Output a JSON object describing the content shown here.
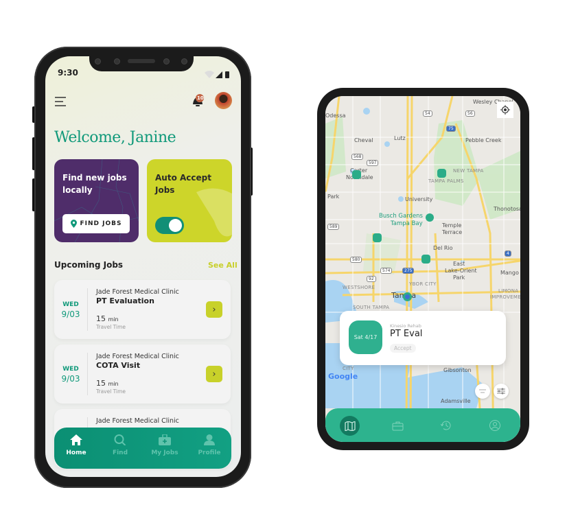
{
  "colors": {
    "brand_green": "#10997a",
    "purple": "#4f2d6a",
    "lime": "#cdd52a",
    "map_accent": "#2db38e"
  },
  "phone_home": {
    "status": {
      "time": "9:30"
    },
    "header": {
      "menu_icon": "hamburger-icon",
      "notification_count": "10",
      "avatar": "user-avatar"
    },
    "welcome": "Welcome, Janine",
    "cards": {
      "find": {
        "title": "Find new jobs locally",
        "button": "FIND JOBS"
      },
      "auto": {
        "title": "Auto Accept Jobs",
        "toggle_on": true
      }
    },
    "upcoming": {
      "title": "Upcoming Jobs",
      "see_all": "See All"
    },
    "jobs": [
      {
        "day": "WED",
        "date": "9/03",
        "clinic": "Jade Forest Medical Clinic",
        "title": "PT Evaluation",
        "minutes": "15",
        "unit": "min",
        "travel": "Travel Time"
      },
      {
        "day": "WED",
        "date": "9/03",
        "clinic": "Jade Forest Medical Clinic",
        "title": "COTA Visit",
        "minutes": "15",
        "unit": "min",
        "travel": "Travel Time"
      },
      {
        "clinic": "Jade Forest Medical Clinic"
      }
    ],
    "nav": [
      {
        "label": "Home",
        "icon": "home-icon",
        "active": true
      },
      {
        "label": "Find",
        "icon": "search-icon"
      },
      {
        "label": "My Jobs",
        "icon": "briefcase-icon"
      },
      {
        "label": "Profile",
        "icon": "user-icon"
      }
    ]
  },
  "phone_map": {
    "map_labels": {
      "wesley": "Wesley Chapel",
      "cheval": "Cheval",
      "lutz": "Lutz",
      "pebble": "Pebble Creek",
      "carter": "Carter",
      "northdale": "Northdale",
      "newtampa": "NEW TAMPA",
      "tampapalms": "TAMPA PALMS",
      "university": "University",
      "busch1": "Busch Gardens",
      "busch2": "Tampa Bay",
      "temple1": "Temple",
      "temple2": "Terrace",
      "thono": "Thonotosassa",
      "delrio": "Del Rio",
      "east1": "East",
      "east2": "Lake-Orient",
      "east3": "Park",
      "mango": "Mango",
      "westshore": "WESTSHORE",
      "ybor": "YBOR CITY",
      "tampa": "Tampa",
      "limona1": "LIMONA",
      "limona2": "IMPROVEMENT",
      "southtampa": "SOUTH TAMPA",
      "gibsonton": "Gibsonton",
      "adamsville": "Adamsville",
      "odessa": "Odessa",
      "park": "Park",
      "city": "CITY"
    },
    "road_shields": [
      "54",
      "56",
      "75",
      "568",
      "597",
      "589",
      "580",
      "574",
      "92",
      "275",
      "4"
    ],
    "google": "Google",
    "event": {
      "clinic": "Kinesio Rehab",
      "title": "PT Eval",
      "date": "Sat 4/17",
      "action": "Accept"
    },
    "nav_icons": [
      "map-icon",
      "briefcase-icon",
      "history-icon",
      "profile-icon"
    ],
    "active_nav": "map-icon"
  }
}
